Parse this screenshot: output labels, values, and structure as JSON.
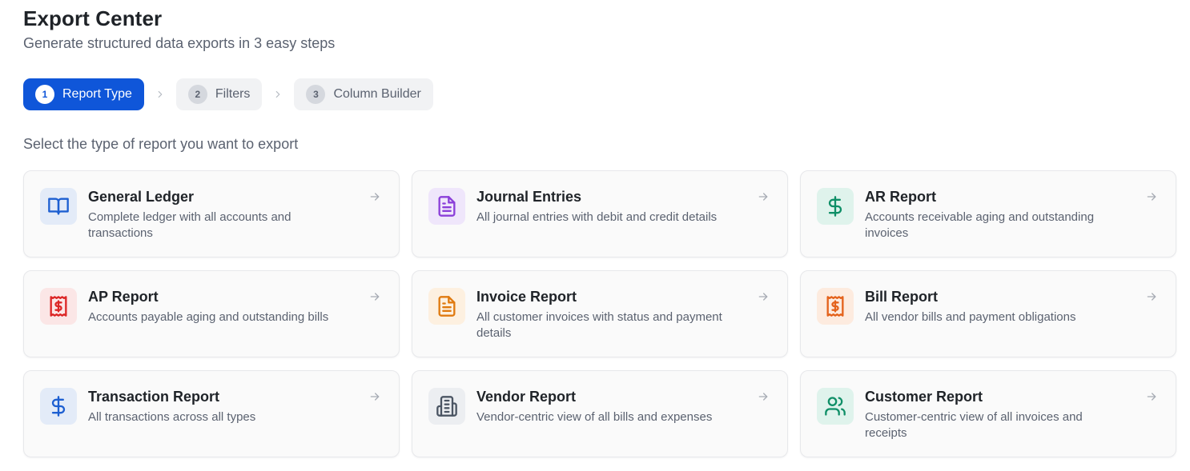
{
  "header": {
    "title": "Export Center",
    "subtitle": "Generate structured data exports in 3 easy steps"
  },
  "steps": [
    {
      "number": "1",
      "label": "Report Type",
      "active": true
    },
    {
      "number": "2",
      "label": "Filters",
      "active": false
    },
    {
      "number": "3",
      "label": "Column Builder",
      "active": false
    }
  ],
  "prompt": "Select the type of report you want to export",
  "colors": {
    "accent": "#0f56d9",
    "arrow": "#a7acb4"
  },
  "reports": [
    {
      "title": "General Ledger",
      "description": "Complete ledger with all accounts and transactions",
      "icon": "book-open-icon",
      "icon_color": "#1d5fd1",
      "icon_bg": "#e3ebf8"
    },
    {
      "title": "Journal Entries",
      "description": "All journal entries with debit and credit details",
      "icon": "document-icon",
      "icon_color": "#8b3fd9",
      "icon_bg": "#efe6fb"
    },
    {
      "title": "AR Report",
      "description": "Accounts receivable aging and outstanding invoices",
      "icon": "dollar-icon",
      "icon_color": "#0f8f67",
      "icon_bg": "#dff3ec"
    },
    {
      "title": "AP Report",
      "description": "Accounts payable aging and outstanding bills",
      "icon": "receipt-icon",
      "icon_color": "#dc2626",
      "icon_bg": "#fbe6e6"
    },
    {
      "title": "Invoice Report",
      "description": "All customer invoices with status and payment details",
      "icon": "document-icon",
      "icon_color": "#e07a10",
      "icon_bg": "#fdf0e0"
    },
    {
      "title": "Bill Report",
      "description": "All vendor bills and payment obligations",
      "icon": "receipt-icon",
      "icon_color": "#e4621b",
      "icon_bg": "#fdebdf"
    },
    {
      "title": "Transaction Report",
      "description": "All transactions across all types",
      "icon": "dollar-icon",
      "icon_color": "#1d5fd1",
      "icon_bg": "#e3ebf8"
    },
    {
      "title": "Vendor Report",
      "description": "Vendor-centric view of all bills and expenses",
      "icon": "building-icon",
      "icon_color": "#4b5563",
      "icon_bg": "#eceef1"
    },
    {
      "title": "Customer Report",
      "description": "Customer-centric view of all invoices and receipts",
      "icon": "users-icon",
      "icon_color": "#0f8f67",
      "icon_bg": "#dff3ec"
    }
  ]
}
